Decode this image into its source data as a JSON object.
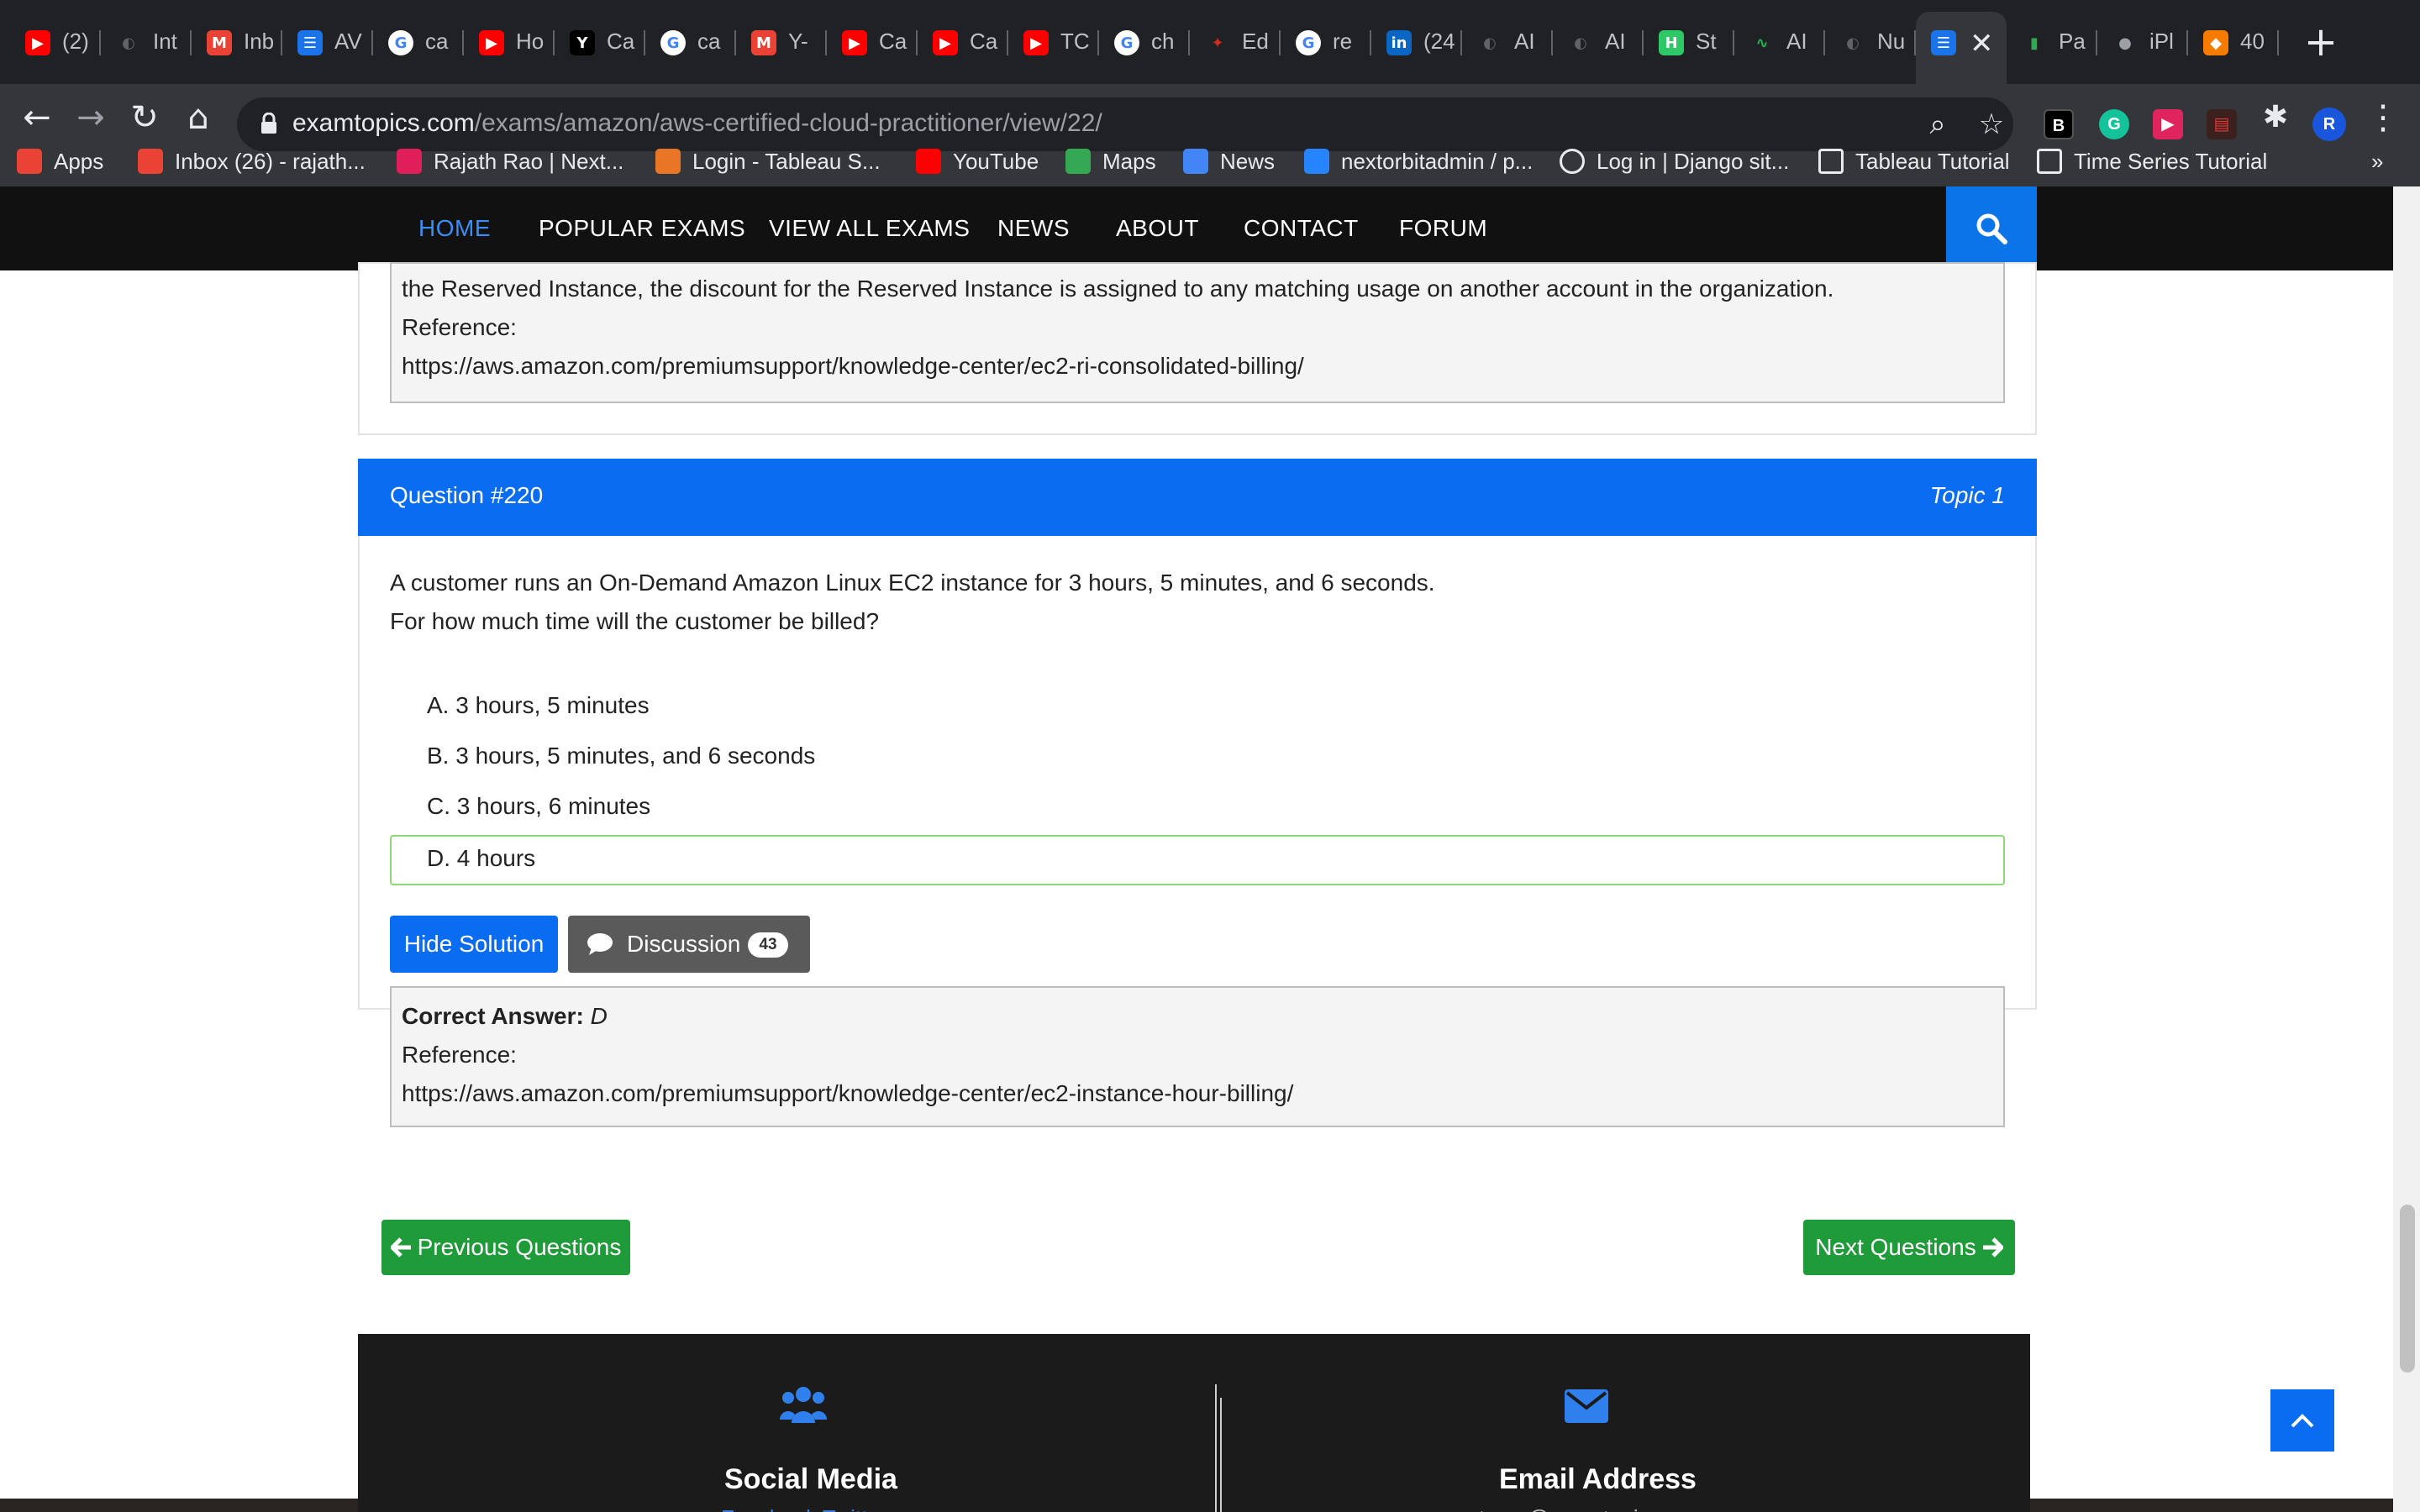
{
  "tabs": [
    {
      "label": "(2)",
      "icon": "youtube-icon",
      "color": "#ff0000",
      "glyph": "▶"
    },
    {
      "label": "Int",
      "icon": "globe-icon",
      "color": "#5f6368",
      "glyph": "◐"
    },
    {
      "label": "Inb",
      "icon": "gmail-icon",
      "color": "#ea4335",
      "glyph": "M"
    },
    {
      "label": "AV",
      "icon": "examtopics-icon",
      "color": "#1a73e8",
      "glyph": "☰"
    },
    {
      "label": "ca",
      "icon": "google-icon",
      "color": "#ffffff",
      "glyph": "G"
    },
    {
      "label": "Ho",
      "icon": "youtube-icon",
      "color": "#ff0000",
      "glyph": "▶"
    },
    {
      "label": "Ca",
      "icon": "ycombinator-icon",
      "color": "#000000",
      "glyph": "Y"
    },
    {
      "label": "ca",
      "icon": "google-icon",
      "color": "#ffffff",
      "glyph": "G"
    },
    {
      "label": "Y-",
      "icon": "gmail-icon",
      "color": "#ea4335",
      "glyph": "M"
    },
    {
      "label": "Ca",
      "icon": "youtube-icon",
      "color": "#ff0000",
      "glyph": "▶"
    },
    {
      "label": "Ca",
      "icon": "youtube-icon",
      "color": "#ff0000",
      "glyph": "▶"
    },
    {
      "label": "TC",
      "icon": "youtube-icon",
      "color": "#ff0000",
      "glyph": "▶"
    },
    {
      "label": "ch",
      "icon": "google-icon",
      "color": "#ffffff",
      "glyph": "G"
    },
    {
      "label": "Ed",
      "icon": "maple-leaf-icon",
      "color": "#d52b1e",
      "glyph": "✦"
    },
    {
      "label": "re",
      "icon": "google-icon",
      "color": "#ffffff",
      "glyph": "G"
    },
    {
      "label": "(24",
      "icon": "linkedin-icon",
      "color": "#0a66c2",
      "glyph": "in"
    },
    {
      "label": "AI",
      "icon": "globe-icon",
      "color": "#5f6368",
      "glyph": "◐"
    },
    {
      "label": "AI",
      "icon": "globe-icon",
      "color": "#5f6368",
      "glyph": "◐"
    },
    {
      "label": "St",
      "icon": "hackerrank-icon",
      "color": "#2ec866",
      "glyph": "H"
    },
    {
      "label": "AI",
      "icon": "chart-icon",
      "color": "#1db954",
      "glyph": "∿"
    },
    {
      "label": "Nu",
      "icon": "globe-icon",
      "color": "#5f6368",
      "glyph": "◐"
    },
    {
      "label": "",
      "icon": "examtopics-icon",
      "color": "#1a73e8",
      "glyph": "☰",
      "active": true
    },
    {
      "label": "Pa",
      "icon": "bars-icon",
      "color": "#34a853",
      "glyph": "▮"
    },
    {
      "label": "iPl",
      "icon": "apple-icon",
      "color": "#9aa0a6",
      "glyph": "●"
    },
    {
      "label": "40",
      "icon": "cube-icon",
      "color": "#f57c00",
      "glyph": "◆"
    }
  ],
  "address": {
    "host": "examtopics.com",
    "path": "/exams/amazon/aws-certified-cloud-practitioner/view/22/"
  },
  "profile_initial": "R",
  "bookmarks": [
    {
      "label": "Apps",
      "icon": "apps-grid-icon",
      "color": "#ea4335"
    },
    {
      "label": "Inbox (26) - rajath...",
      "icon": "gmail-icon",
      "color": "#ea4335"
    },
    {
      "label": "Rajath Rao | Next...",
      "icon": "slack-icon",
      "color": "#e01e5a"
    },
    {
      "label": "Login - Tableau S...",
      "icon": "tableau-icon",
      "color": "#e97627"
    },
    {
      "label": "YouTube",
      "icon": "youtube-icon",
      "color": "#ff0000"
    },
    {
      "label": "Maps",
      "icon": "maps-pin-icon",
      "color": "#34a853"
    },
    {
      "label": "News",
      "icon": "news-icon",
      "color": "#4285f4"
    },
    {
      "label": "nextorbitadmin / p...",
      "icon": "bitbucket-icon",
      "color": "#2684ff"
    },
    {
      "label": "Log in | Django sit...",
      "icon": "globe-icon",
      "color": "#e8eaed"
    },
    {
      "label": "Tableau Tutorial",
      "icon": "tutorial-icon",
      "color": "#e8eaed"
    },
    {
      "label": "Time Series Tutorial",
      "icon": "tutorial-icon",
      "color": "#e8eaed"
    }
  ],
  "bookmarks_overflow": "»",
  "nav": {
    "items": [
      "HOME",
      "POPULAR EXAMS",
      "VIEW ALL EXAMS",
      "NEWS",
      "ABOUT",
      "CONTACT",
      "FORUM"
    ]
  },
  "prev_answer": {
    "line1": "the Reserved Instance, the discount for the Reserved Instance is assigned to any matching usage on another account in the organization.",
    "reference_label": "Reference:",
    "reference_url": "https://aws.amazon.com/premiumsupport/knowledge-center/ec2-ri-consolidated-billing/"
  },
  "question": {
    "title": "Question #220",
    "topic": "Topic 1",
    "text_line1": "A customer runs an On-Demand Amazon Linux EC2 instance for 3 hours, 5 minutes, and 6 seconds.",
    "text_line2": "For how much time will the customer be billed?",
    "choices": [
      "A. 3 hours, 5 minutes",
      "B. 3 hours, 5 minutes, and 6 seconds",
      "C. 3 hours, 6 minutes",
      "D. 4 hours"
    ],
    "hide_solution_label": "Hide Solution",
    "discussion_label": "Discussion",
    "discussion_count": "43",
    "correct_answer_label": "Correct Answer:",
    "correct_answer_value": "D",
    "reference_label": "Reference:",
    "reference_url": "https://aws.amazon.com/premiumsupport/knowledge-center/ec2-instance-hour-billing/"
  },
  "pagination": {
    "prev_label": "Previous Questions",
    "next_label": "Next Questions"
  },
  "footer": {
    "social_title": "Social Media",
    "social_links": "Facebook Twitter",
    "email_title": "Email Address",
    "email_value": "team@examtopics.com"
  },
  "colors": {
    "accent": "#0a6cf0",
    "success": "#1f9b3a",
    "nav_bg": "#111111",
    "correct_border": "#8bd97a"
  }
}
